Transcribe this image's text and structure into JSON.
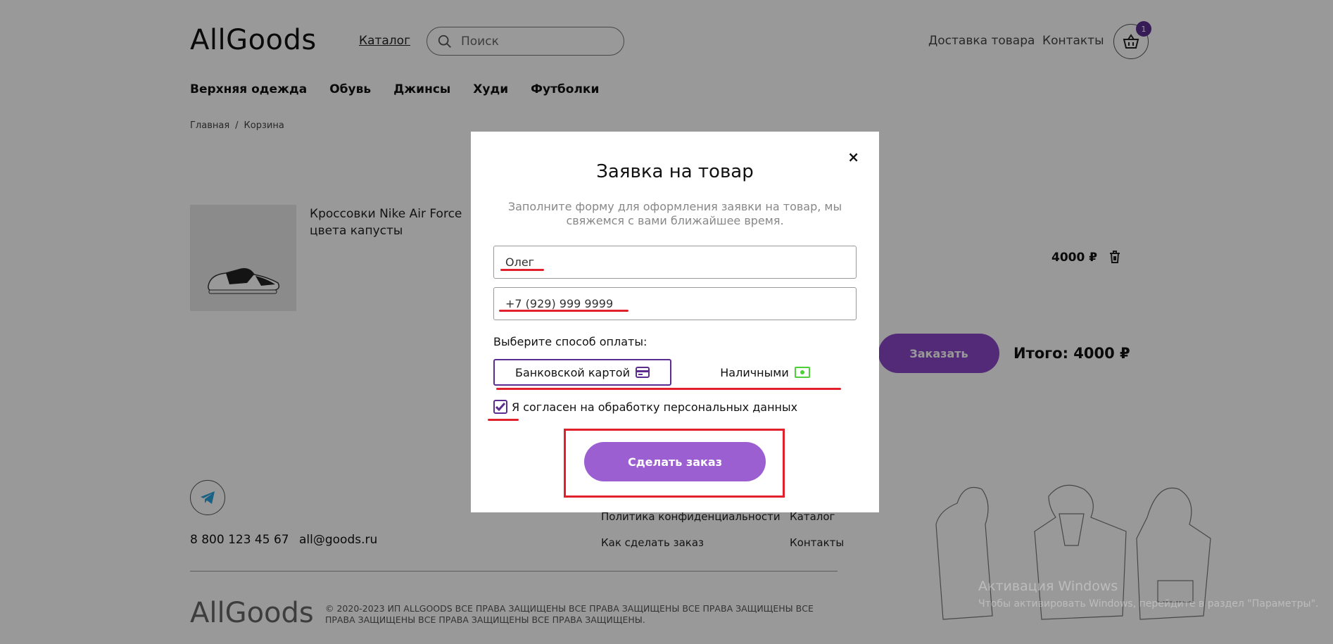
{
  "header": {
    "logo": "AllGoods",
    "catalog": "Каталог",
    "search_placeholder": "Поиск",
    "delivery": "Доставка товара",
    "contacts": "Контакты",
    "cart_count": "1"
  },
  "categories": [
    "Верхняя одежда",
    "Обувь",
    "Джинсы",
    "Худи",
    "Футболки"
  ],
  "breadcrumb": {
    "home": "Главная",
    "sep": "/",
    "current": "Корзина"
  },
  "cart": {
    "product_name": "Кроссовки Nike Air Force цвета капусты",
    "price": "4000 ₽",
    "order_button": "Заказать",
    "total": "Итого: 4000 ₽"
  },
  "footer": {
    "phone": "8 800 123 45 67",
    "email": "all@goods.ru",
    "privacy": "Политика конфиденциальности",
    "how_to_order": "Как сделать заказ",
    "catalog": "Каталог",
    "contacts": "Контакты",
    "logo": "AllGoods",
    "copyright": "© 2020-2023 ИП ALLGOODS ВСЕ ПРАВА ЗАЩИЩЕНЫ ВСЕ ПРАВА ЗАЩИЩЕНЫ ВСЕ ПРАВА ЗАЩИЩЕНЫ ВСЕ ПРАВА ЗАЩИЩЕНЫ ВСЕ ПРАВА ЗАЩИЩЕНЫ ВСЕ ПРАВА ЗАЩИЩЕНЫ."
  },
  "modal": {
    "close": "×",
    "title": "Заявка на товар",
    "subtitle": "Заполните форму для оформления заявки на товар, мы свяжемся с вами ближайшее время.",
    "name_value": "Олег",
    "phone_value": "+7 (929) 999 9999",
    "payment_label": "Выберите способ оплаты:",
    "pay_card": "Банковской картой",
    "pay_cash": "Наличными",
    "consent": "Я согласен на обработку персональных данных",
    "submit": "Сделать заказ"
  },
  "watermark": {
    "title": "Активация Windows",
    "sub": "Чтобы активировать Windows, перейдите в раздел \"Параметры\"."
  },
  "colors": {
    "brand": "#5b2d91",
    "button": "#9c5fd1",
    "annotation": "#e0202a",
    "cash_icon": "#4cd137"
  }
}
